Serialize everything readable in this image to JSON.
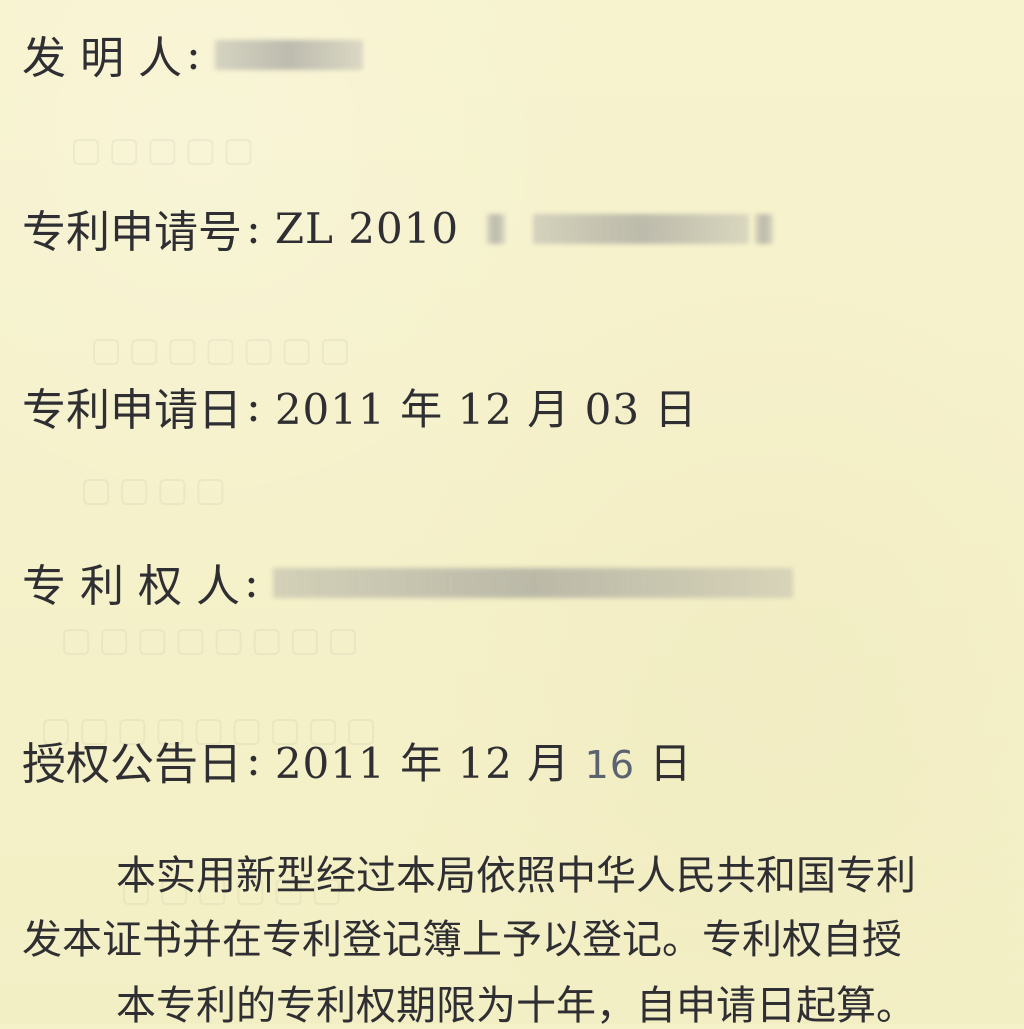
{
  "certificate": {
    "inventor_label": "发 明 人",
    "application_number_label": "专利申请号",
    "application_number_value": "ZL 2010",
    "application_date_label": "专利申请日",
    "application_date_value": {
      "year": "2011",
      "year_unit": "年",
      "month": "12",
      "month_unit": "月",
      "day": "03",
      "day_unit": "日"
    },
    "patentee_label": "专 利 权 人",
    "announcement_date_label": "授权公告日",
    "announcement_date_value": {
      "year": "2011",
      "year_unit": "年",
      "month": "12",
      "month_unit": "月",
      "day": "16",
      "day_unit": "日"
    },
    "body_lines": [
      "本实用新型经过本局依照中华人民共和国专利",
      "发本证书并在专利登记簿上予以登记。专利权自授",
      "本专利的专利权期限为十年，自申请日起算。"
    ]
  }
}
